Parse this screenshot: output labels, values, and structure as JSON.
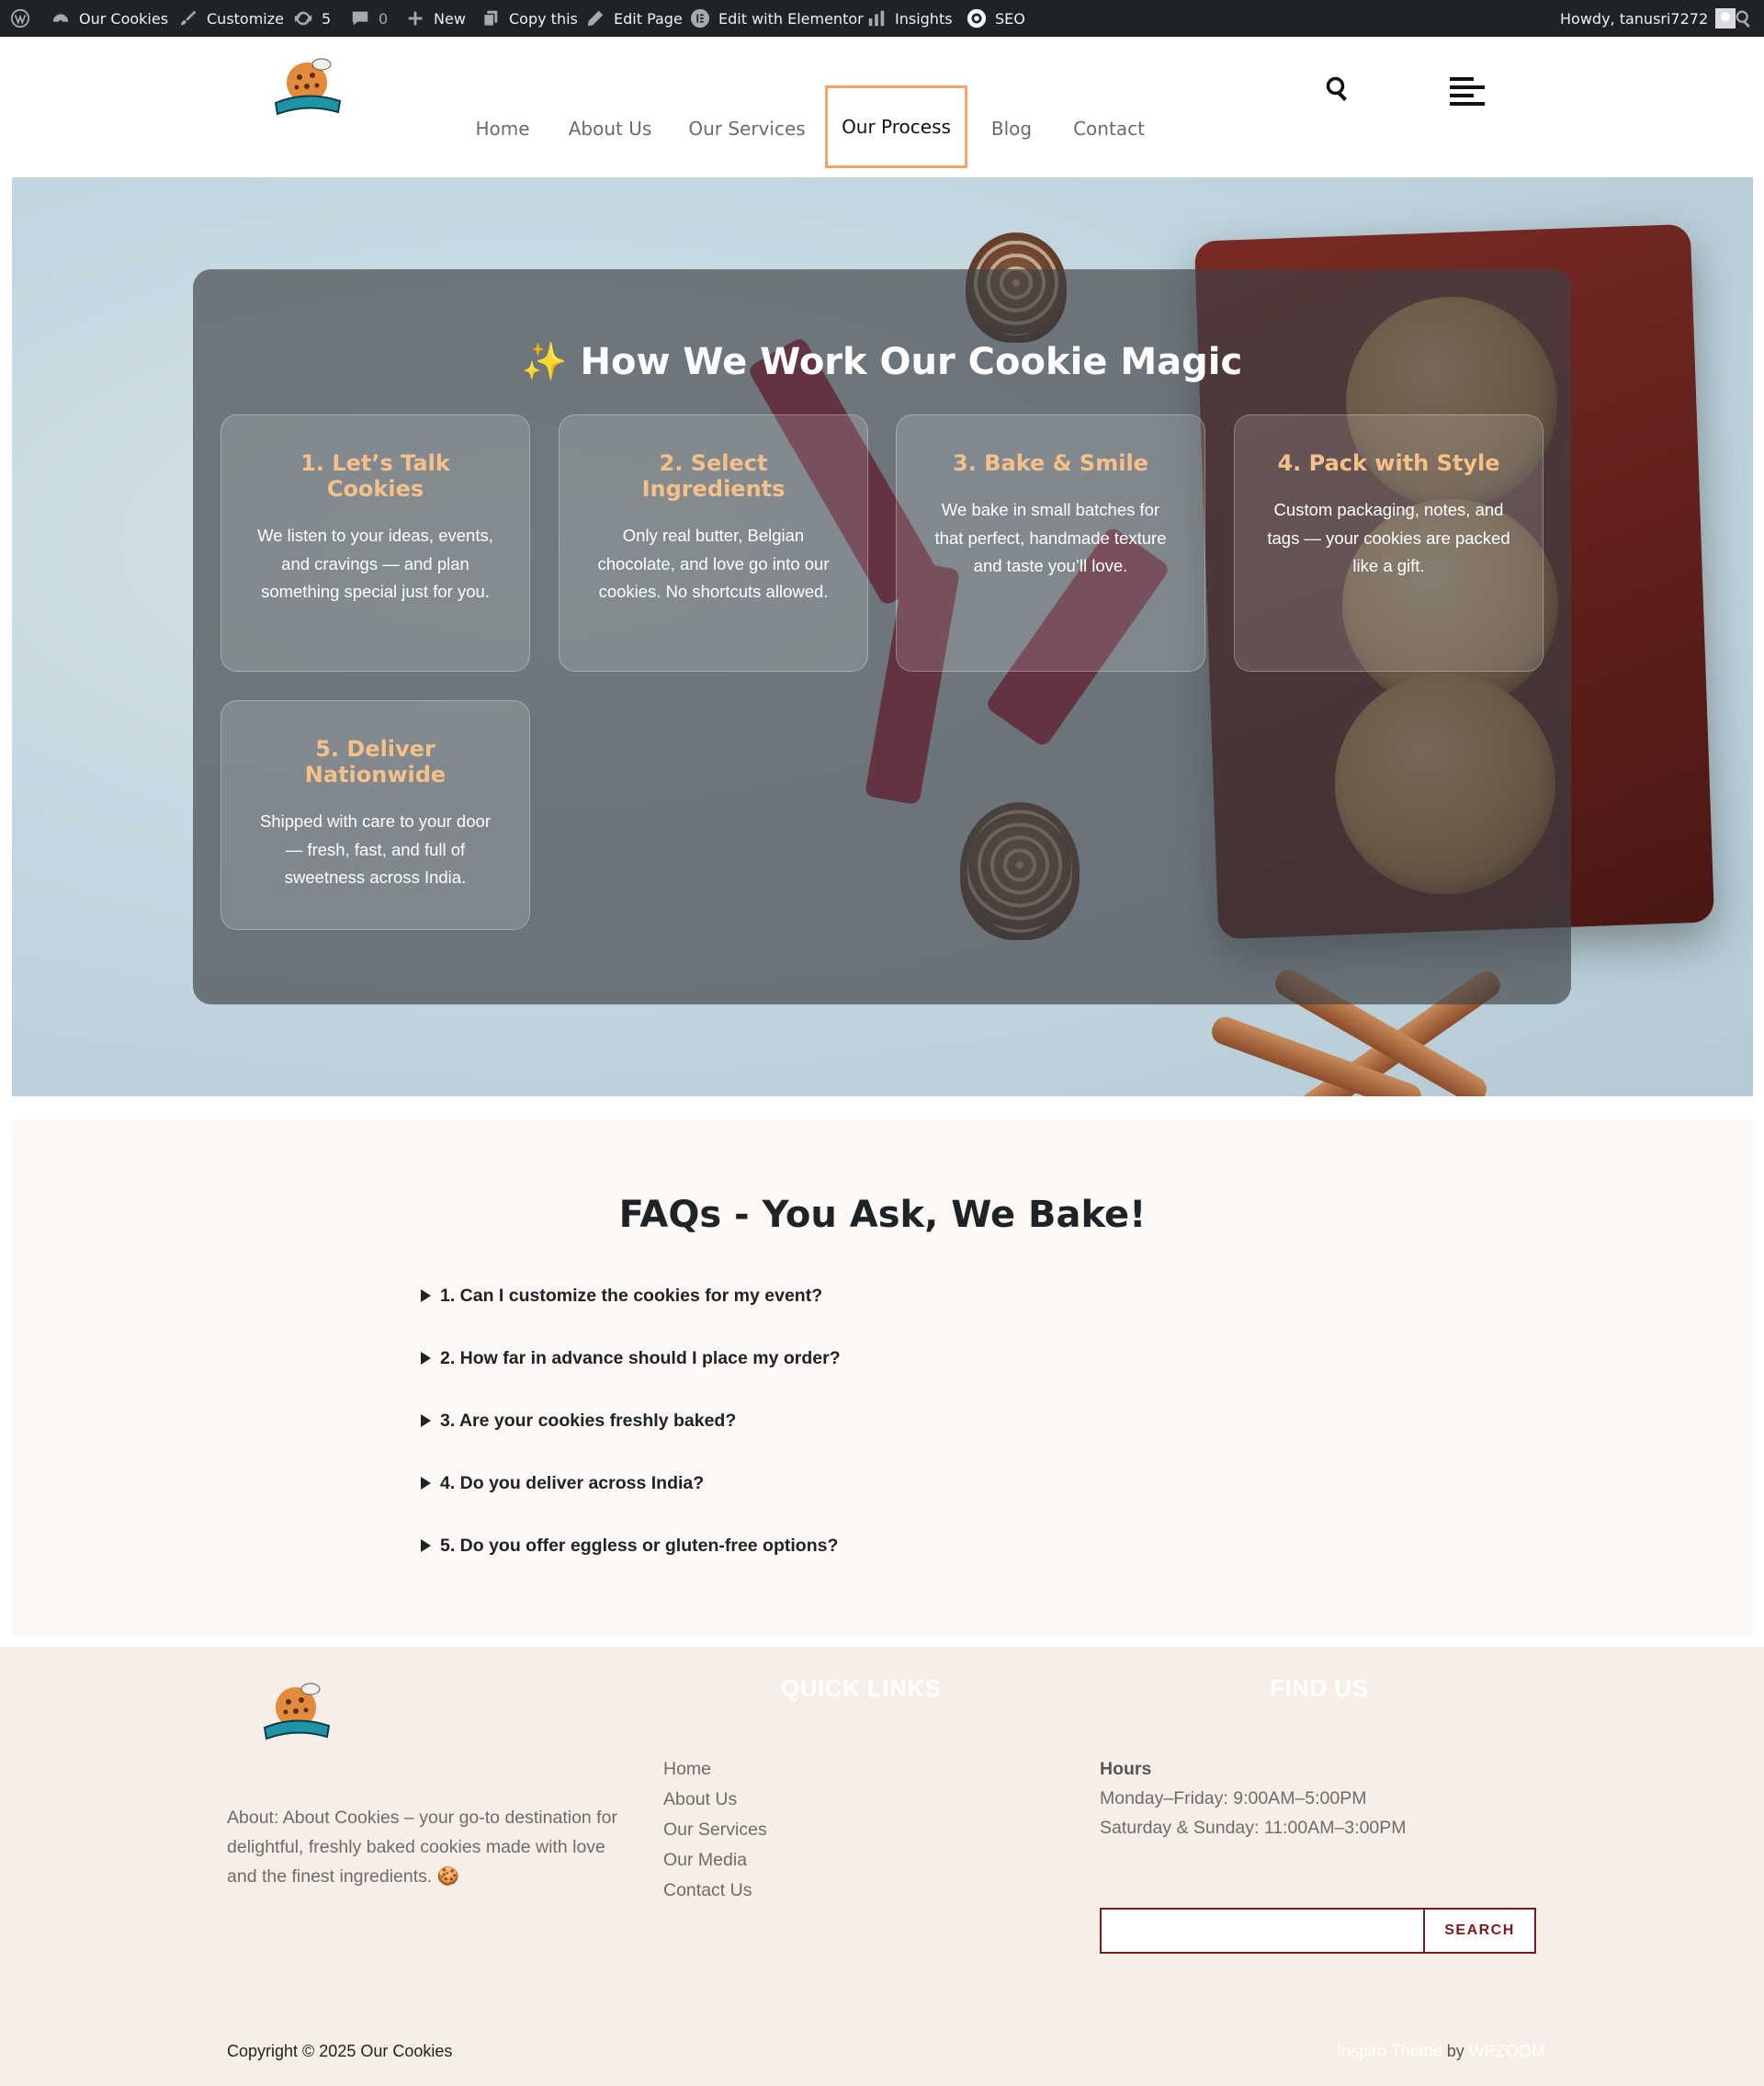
{
  "admin_bar": {
    "site_name": "Our Cookies",
    "customize": "Customize",
    "updates_count": "5",
    "comments_count": "0",
    "new_label": "New",
    "copy_label": "Copy this",
    "edit_page": "Edit Page",
    "edit_elementor": "Edit with Elementor",
    "insights": "Insights",
    "seo": "SEO",
    "greeting": "Howdy, tanusri7272"
  },
  "nav": {
    "items": [
      "Home",
      "About Us",
      "Our Services",
      "Our Process",
      "Blog",
      "Contact"
    ],
    "active": "Our Process"
  },
  "process": {
    "title": "How We Work Our Cookie Magic",
    "sparkle": "✨",
    "steps": [
      {
        "title": "1. Let’s Talk Cookies",
        "text": "We listen to your ideas, events, and cravings — and plan something special just for you."
      },
      {
        "title": "2. Select Ingredients",
        "text": "Only real butter, Belgian chocolate, and love go into our cookies. No shortcuts allowed."
      },
      {
        "title": "3. Bake & Smile",
        "text": "We bake in small batches for that perfect, handmade texture and taste you’ll love."
      },
      {
        "title": "4. Pack with Style",
        "text": "Custom packaging, notes, and tags — your cookies are packed like a gift."
      },
      {
        "title": "5. Deliver Nationwide",
        "text": "Shipped with care to your door — fresh, fast, and full of sweetness across India."
      }
    ]
  },
  "faq": {
    "title": "FAQs - You Ask, We Bake!",
    "items": [
      "1. Can I customize the cookies for my event?",
      "2. How far in advance should I place my order?",
      "3. Are your cookies freshly baked?",
      "4. Do you deliver across India?",
      "5. Do you offer eggless or gluten-free options?"
    ]
  },
  "footer": {
    "about": "About: About Cookies – your go-to destination for delightful, freshly baked cookies made with love and the finest ingredients.",
    "about_emoji": "🍪",
    "quick_links_title": "QUICK LINKS",
    "quick_links": [
      "Home",
      "About Us",
      "Our Services",
      "Our Media",
      "Contact Us"
    ],
    "find_us_title": "FIND US",
    "hours_title": "Hours",
    "hours": [
      "Monday–Friday: 9:00AM–5:00PM",
      "Saturday & Sunday: 11:00AM–3:00PM"
    ],
    "search_button": "SEARCH",
    "copyright": "Copyright © 2025 Our Cookies",
    "credit_theme": "Inspiro Theme",
    "credit_by": "by",
    "credit_author": "WPZOOM"
  },
  "colors": {
    "admin_bar_bg": "#1d2327",
    "accent_orange": "#f7a26b",
    "step_title": "#f6c08a",
    "brand_maroon": "#7a1b1b",
    "footer_bg": "#f8eee8"
  }
}
